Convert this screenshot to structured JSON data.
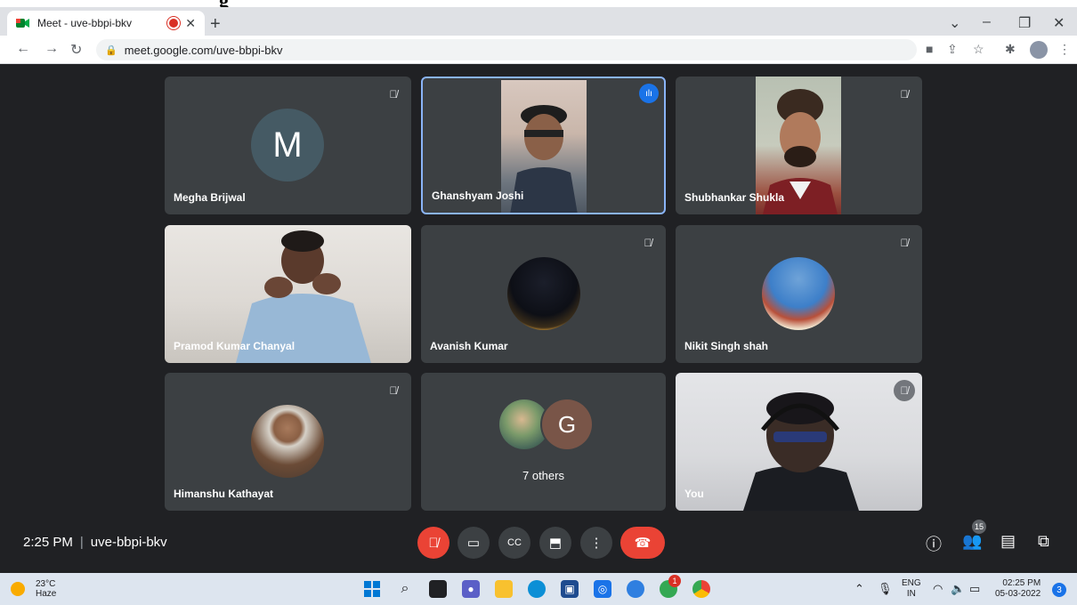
{
  "browser": {
    "tab_title": "Meet - uve-bbpi-bkv",
    "url": "meet.google.com/uve-bbpi-bkv"
  },
  "participants": [
    {
      "name": "Megha Brijwal",
      "avatar_letter": "M",
      "muted": true
    },
    {
      "name": "Ghanshyam Joshi",
      "speaking": true
    },
    {
      "name": "Shubhankar Shukla",
      "muted": true
    },
    {
      "name": "Pramod Kumar Chanyal"
    },
    {
      "name": "Avanish Kumar",
      "muted": true
    },
    {
      "name": "Nikit Singh shah",
      "muted": true
    },
    {
      "name": "Himanshu Kathayat",
      "muted": true
    },
    {
      "others_label": "7 others",
      "avatar_letter": "G"
    },
    {
      "name": "You",
      "muted": true
    }
  ],
  "meeting": {
    "time": "2:25 PM",
    "code": "uve-bbpi-bkv",
    "participant_count": "15"
  },
  "taskbar": {
    "temperature": "23°C",
    "weather": "Haze",
    "lang_top": "ENG",
    "lang_bottom": "IN",
    "clock_time": "02:25 PM",
    "clock_date": "05-03-2022",
    "notification_count": "3",
    "edge_badge": "1"
  }
}
